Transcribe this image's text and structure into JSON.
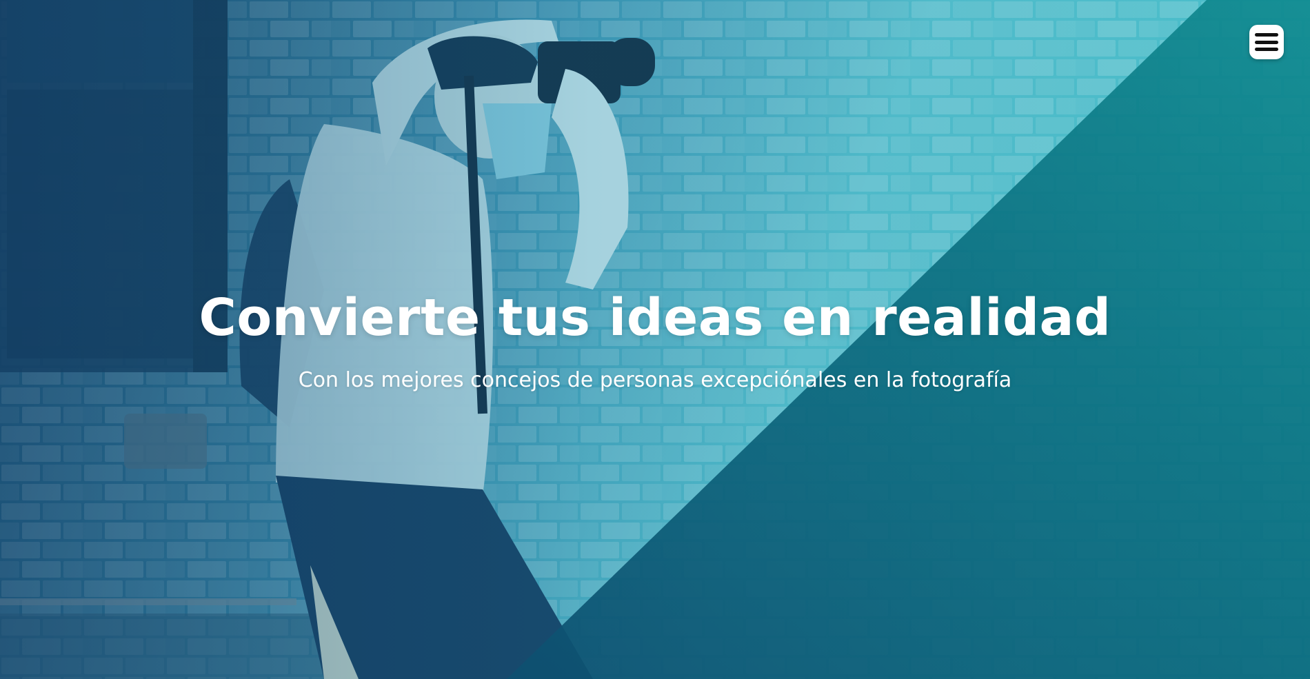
{
  "hero": {
    "title": "Convierte tus ideas en realidad",
    "subtitle": "Con los mejores concejos de personas excepciónales en la fotografía"
  },
  "menu": {
    "icon": "hamburger-menu-icon"
  },
  "colors": {
    "overlay_dark": "#1d4f72",
    "overlay_light": "#58c2cf",
    "diagonal_panel": "#0e6f7e",
    "text": "#ffffff",
    "menu_bg": "#ffffff"
  }
}
